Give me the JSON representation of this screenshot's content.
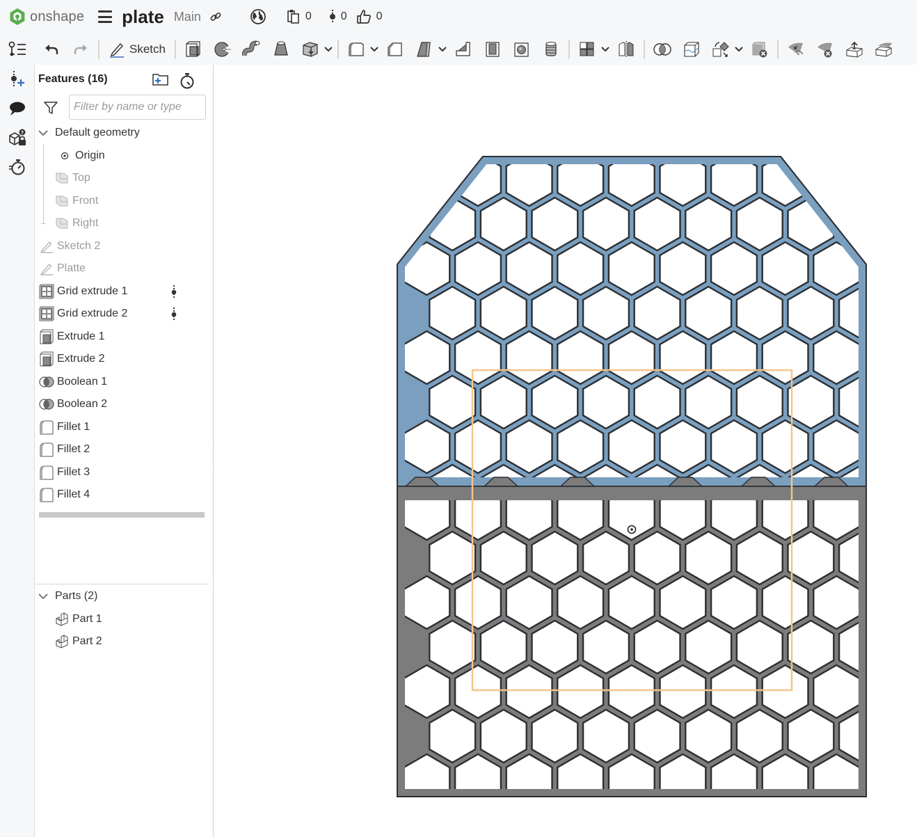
{
  "app": {
    "brand": "onshape",
    "document_title": "plate",
    "workspace": "Main"
  },
  "header": {
    "counts": [
      {
        "icon": "documents-icon",
        "value": "0"
      },
      {
        "icon": "versions-icon",
        "value": "0"
      },
      {
        "icon": "thumbs-up-icon",
        "value": "0"
      }
    ]
  },
  "toolbar": {
    "sketch_label": "Sketch",
    "tools": [
      "extrude",
      "revolve",
      "sweep",
      "loft",
      "thicken",
      "fillet",
      "chamfer",
      "draft",
      "rib",
      "shell",
      "hole",
      "thread",
      "pattern",
      "mirror",
      "boolean",
      "split",
      "transform",
      "delete-part",
      "modify-fillet",
      "delete-face",
      "move-face",
      "replace-face"
    ]
  },
  "panel": {
    "title": "Features (16)",
    "filter_placeholder": "Filter by name or type",
    "default_geometry_label": "Default geometry",
    "default_geometry": [
      {
        "label": "Origin",
        "icon": "origin-icon",
        "dim": false
      },
      {
        "label": "Top",
        "icon": "plane-icon",
        "dim": true
      },
      {
        "label": "Front",
        "icon": "plane-icon",
        "dim": true
      },
      {
        "label": "Right",
        "icon": "plane-icon",
        "dim": true
      }
    ],
    "features": [
      {
        "label": "Sketch 2",
        "icon": "sketch-icon",
        "dim": true,
        "menu": false
      },
      {
        "label": "Platte",
        "icon": "sketch-icon",
        "dim": true,
        "menu": false
      },
      {
        "label": "Grid extrude 1",
        "icon": "grid-extrude-icon",
        "dim": false,
        "menu": true
      },
      {
        "label": "Grid extrude 2",
        "icon": "grid-extrude-icon",
        "dim": false,
        "menu": true
      },
      {
        "label": "Extrude 1",
        "icon": "extrude-icon",
        "dim": false,
        "menu": false
      },
      {
        "label": "Extrude 2",
        "icon": "extrude-icon",
        "dim": false,
        "menu": false
      },
      {
        "label": "Boolean 1",
        "icon": "boolean-icon",
        "dim": false,
        "menu": false
      },
      {
        "label": "Boolean 2",
        "icon": "boolean-icon",
        "dim": false,
        "menu": false
      },
      {
        "label": "Fillet 1",
        "icon": "fillet-icon",
        "dim": false,
        "menu": false
      },
      {
        "label": "Fillet 2",
        "icon": "fillet-icon",
        "dim": false,
        "menu": false
      },
      {
        "label": "Fillet 3",
        "icon": "fillet-icon",
        "dim": false,
        "menu": false
      },
      {
        "label": "Fillet 4",
        "icon": "fillet-icon",
        "dim": false,
        "menu": false
      }
    ],
    "parts_label": "Parts (2)",
    "parts": [
      "Part 1",
      "Part 2"
    ]
  },
  "viewport": {
    "colors": {
      "part1": "#7a9fbf",
      "part2": "#7c7c7c",
      "edge": "#2b2f33",
      "selection_box": "#f5c48a",
      "background": "#ffffff"
    }
  }
}
